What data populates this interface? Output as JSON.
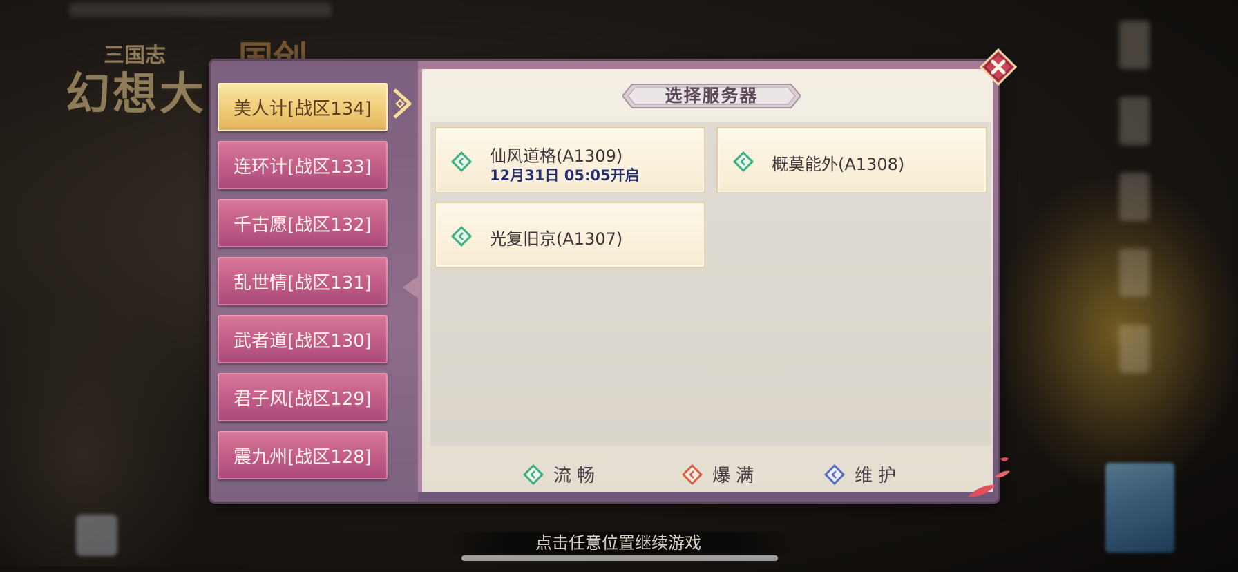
{
  "background": {
    "logo_main": "幻想大陆",
    "logo_top": "三国志",
    "logo_extra": "国创"
  },
  "dialog": {
    "title": "选择服务器",
    "zones": [
      {
        "label": "美人计[战区134]",
        "active": true
      },
      {
        "label": "连环计[战区133]",
        "active": false
      },
      {
        "label": "千古愿[战区132]",
        "active": false
      },
      {
        "label": "乱世情[战区131]",
        "active": false
      },
      {
        "label": "武者道[战区130]",
        "active": false
      },
      {
        "label": "君子风[战区129]",
        "active": false
      },
      {
        "label": "震九州[战区128]",
        "active": false
      }
    ],
    "servers": [
      {
        "name": "仙风道格(A1309)",
        "time": "12月31日 05:05开启",
        "status": "smooth"
      },
      {
        "name": "概莫能外(A1308)",
        "status": "smooth"
      },
      {
        "name": "光复旧京(A1307)",
        "status": "smooth"
      }
    ],
    "legend": [
      {
        "label": "流畅",
        "color": "#3fae7e",
        "status": "smooth"
      },
      {
        "label": "爆满",
        "color": "#d0623f",
        "status": "full"
      },
      {
        "label": "维护",
        "color": "#5a6fc4",
        "status": "maintenance"
      }
    ]
  },
  "hint": "点击任意位置继续游戏",
  "colors": {
    "active_zone": "#f0cc77",
    "zone": "#c15c86",
    "smooth": "#3fae7e",
    "full": "#d0623f",
    "maintenance": "#5a6fc4",
    "close": "#b8354a"
  }
}
